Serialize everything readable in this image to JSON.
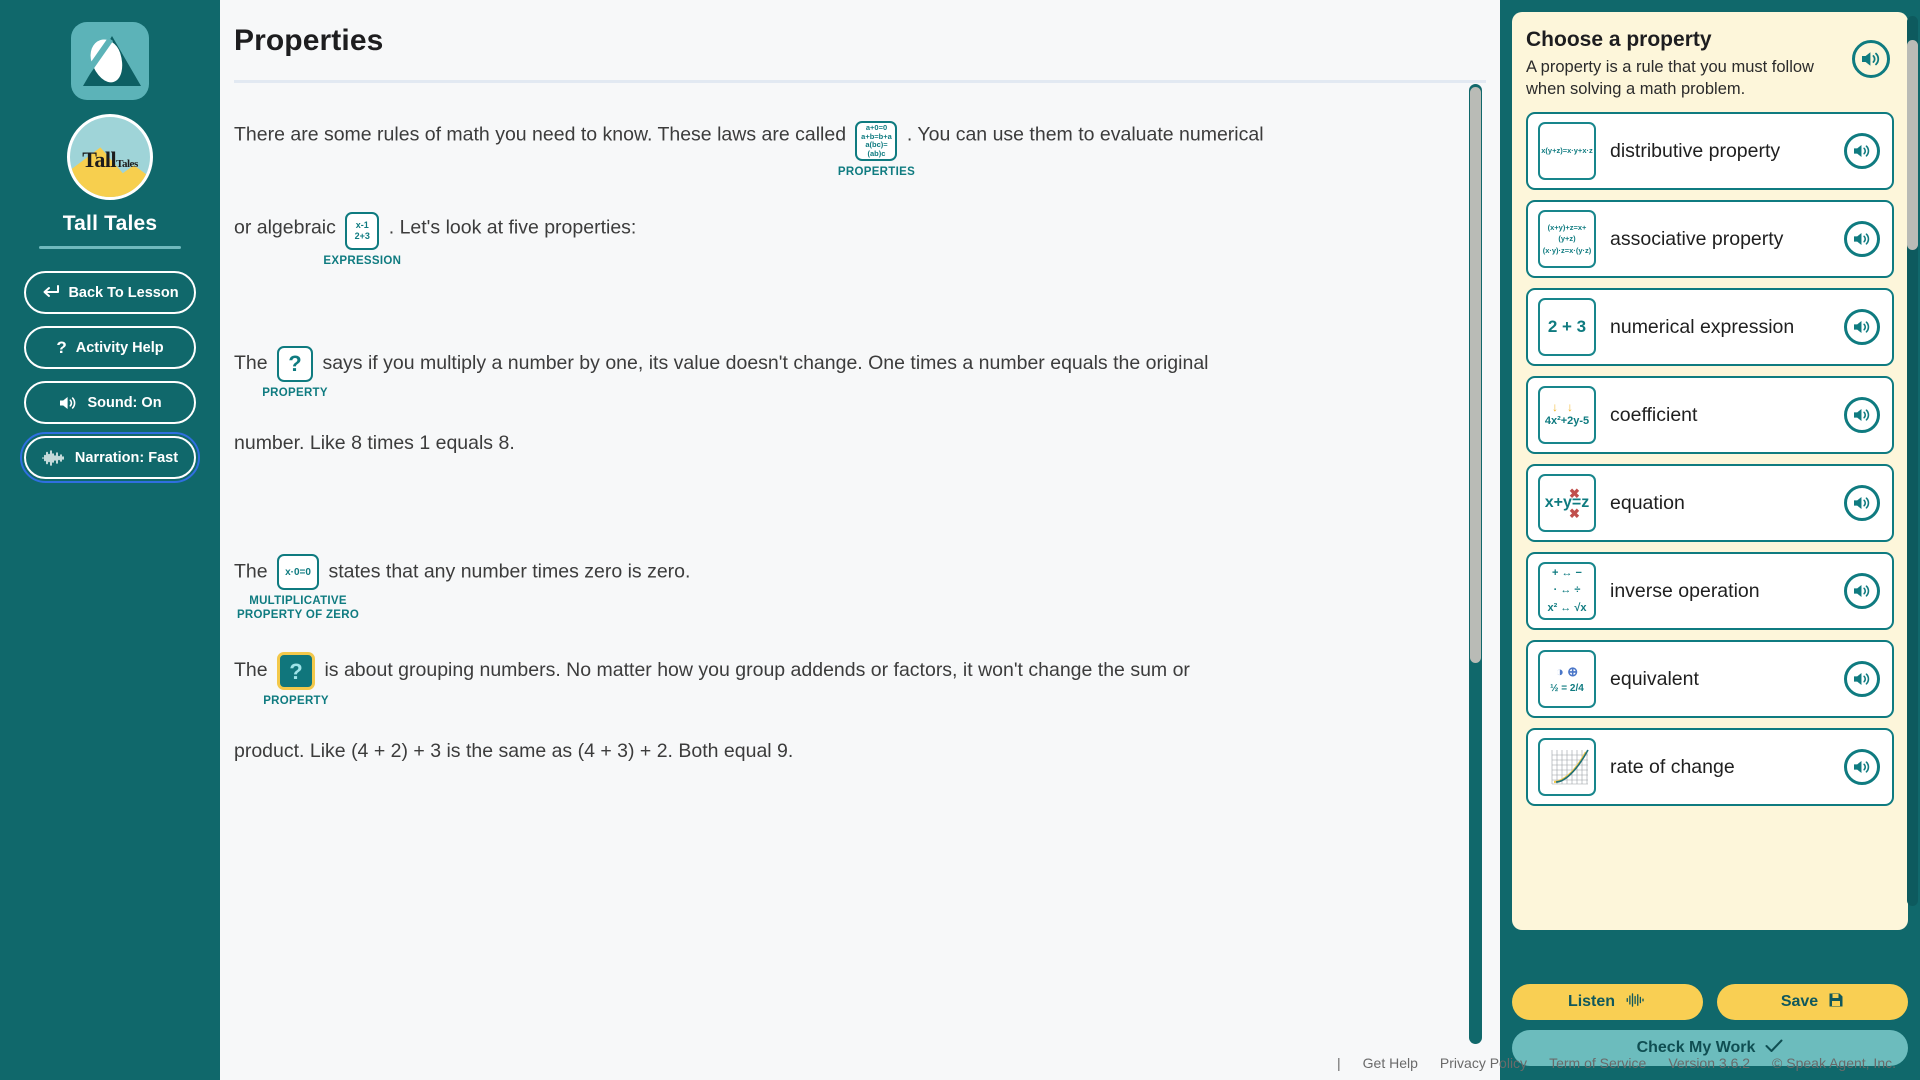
{
  "sidebar": {
    "brand_title": "Tall Tales",
    "logo_main": "Tall",
    "logo_sub": "Tales",
    "buttons": [
      {
        "label": "Back To Lesson",
        "icon": "return-arrow-icon",
        "glyph": "↵",
        "focused": false
      },
      {
        "label": "Activity Help",
        "icon": "question-mark-icon",
        "glyph": "?",
        "focused": false
      },
      {
        "label": "Sound: On",
        "icon": "speaker-icon",
        "glyph": "🔊",
        "focused": false
      },
      {
        "label": "Narration: Fast",
        "icon": "waveform-icon",
        "glyph": "‖",
        "focused": true
      }
    ]
  },
  "main": {
    "title": "Properties",
    "paragraphs": [
      {
        "id": "p1",
        "before": "There are some rules of math you need to know. These laws are called",
        "blank": {
          "kind": "filled",
          "lines": [
            "a+0=0",
            "a+b=b+a",
            "a(bc)=(ab)c"
          ],
          "caption": "PROPERTIES"
        },
        "after": ". You can use them to evaluate numerical"
      },
      {
        "id": "p2",
        "before": "or algebraic",
        "blank": {
          "kind": "filled",
          "lines": [
            "x-1",
            "2+3"
          ],
          "caption": "EXPRESSION"
        },
        "after": ". Let's look at five properties:"
      },
      {
        "id": "p3",
        "before": "The",
        "blank": {
          "kind": "empty",
          "lines": [
            "?"
          ],
          "caption": "PROPERTY"
        },
        "after": "says if you multiply a number by one, its value doesn't change. One times a number equals the original"
      },
      {
        "id": "p4",
        "text": "number. Like 8 times 1 equals 8."
      },
      {
        "id": "p5",
        "before": "The",
        "blank": {
          "kind": "filled",
          "lines": [
            "x·0=0"
          ],
          "caption": "MULTIPLICATIVE PROPERTY OF ZERO"
        },
        "after": "states that any number times zero is zero."
      },
      {
        "id": "p6",
        "before": "The",
        "blank": {
          "kind": "selected",
          "lines": [
            "?"
          ],
          "caption": "PROPERTY"
        },
        "after": "is about grouping numbers. No matter how you group addends or factors, it won't change the sum or"
      },
      {
        "id": "p7",
        "text": "product. Like (4 + 2) + 3 is the same as (4 + 3) + 2. Both equal 9."
      }
    ]
  },
  "panel": {
    "heading": "Choose a property",
    "description": "A property is a rule that you must follow when solving a math problem.",
    "header_speaker_icon": "speaker-icon",
    "items": [
      {
        "label": "distributive property",
        "icon_lines": [
          "x(y+z)=x·y+x·z"
        ],
        "icon_style": "small",
        "speaker_icon": "speaker-icon"
      },
      {
        "label": "associative property",
        "icon_lines": [
          "(x+y)+z=x+(y+z)",
          "(x·y)·z=x·(y·z)"
        ],
        "icon_style": "small",
        "speaker_icon": "speaker-icon"
      },
      {
        "label": "numerical expression",
        "icon_lines": [
          "2 + 3"
        ],
        "icon_style": "big",
        "speaker_icon": "speaker-icon"
      },
      {
        "label": "coefficient",
        "icon_lines": [
          "4x²+2y-5"
        ],
        "icon_style": "small",
        "speaker_icon": "speaker-icon"
      },
      {
        "label": "equation",
        "icon_lines": [
          "x+y=z"
        ],
        "icon_style": "big",
        "speaker_icon": "speaker-icon"
      },
      {
        "label": "inverse operation",
        "icon_lines": [
          "+ ↔ −",
          "· ↔ ÷",
          "x² ↔ √x"
        ],
        "icon_style": "small",
        "speaker_icon": "speaker-icon"
      },
      {
        "label": "equivalent",
        "icon_lines": [
          "◑ ⊕",
          "½ = 2/4"
        ],
        "icon_style": "small",
        "speaker_icon": "speaker-icon"
      },
      {
        "label": "rate of change",
        "icon_lines": [
          "graph"
        ],
        "icon_style": "graph",
        "speaker_icon": "speaker-icon"
      }
    ],
    "actions": {
      "listen": "Listen",
      "listen_icon": "waveform-icon",
      "save": "Save",
      "save_icon": "floppy-disk-icon",
      "check": "Check My Work",
      "check_icon": "checkmark-icon"
    }
  },
  "footer": {
    "separator": "|",
    "links": [
      "Get Help",
      "Privacy Policy",
      "Term of Service"
    ],
    "version": "Version 3.6.2",
    "copyright": "© Speak Agent, Inc."
  },
  "colors": {
    "teal": "#10686b",
    "teal_accent": "#0f7b80",
    "cream": "#fdf6da",
    "yellow": "#f9cf53",
    "light_teal": "#6cbcbd"
  }
}
